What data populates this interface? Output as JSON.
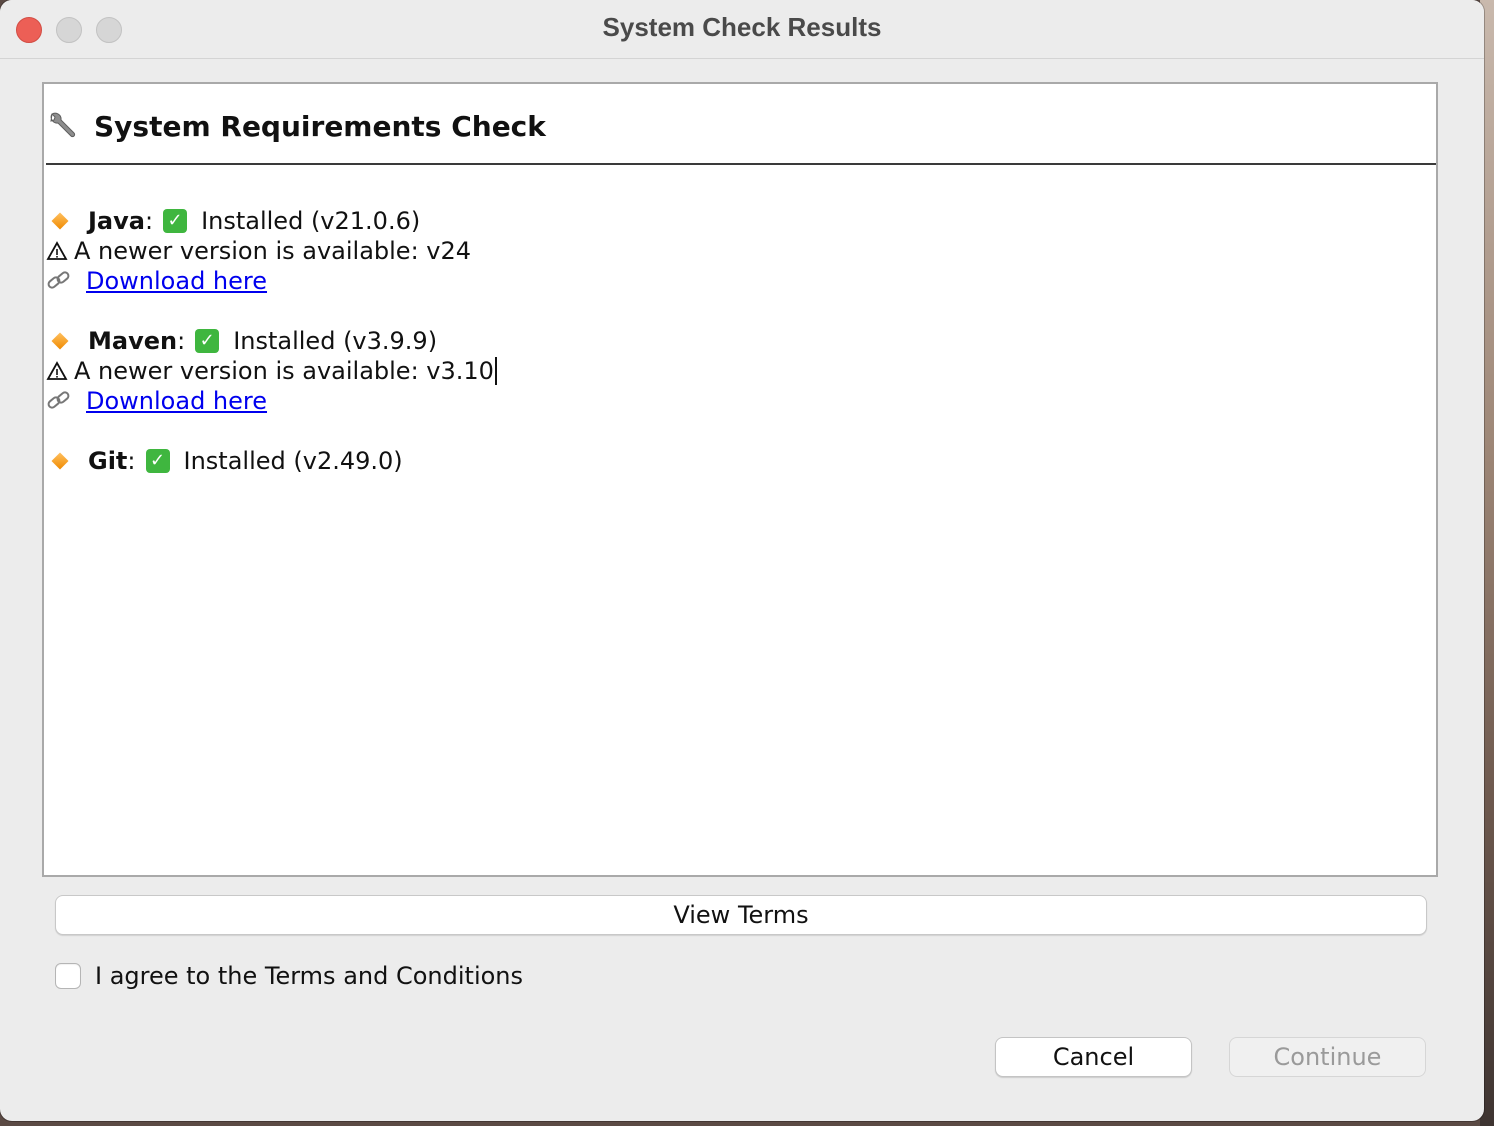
{
  "window": {
    "title": "System Check Results"
  },
  "panel": {
    "title": "System Requirements Check",
    "icon": "wrench-icon"
  },
  "items": [
    {
      "name": "Java",
      "separator": ":",
      "status": "Installed (v21.0.6)",
      "warning": "A newer version is available: v24",
      "link_label": "Download here"
    },
    {
      "name": "Maven",
      "separator": ":",
      "status": "Installed (v3.9.9)",
      "warning": "A newer version is available: v3.10",
      "link_label": "Download here"
    },
    {
      "name": "Git",
      "separator": ":",
      "status": "Installed (v2.49.0)"
    }
  ],
  "controls": {
    "view_terms_label": "View Terms",
    "agree_label": "I agree to the Terms and Conditions",
    "agree_checked": false,
    "cancel_label": "Cancel",
    "continue_label": "Continue",
    "continue_enabled": false
  },
  "colors": {
    "link": "#0000ee",
    "check": "#3fb63f",
    "diamond": "#f08a00",
    "close_button": "#ec5f56"
  }
}
